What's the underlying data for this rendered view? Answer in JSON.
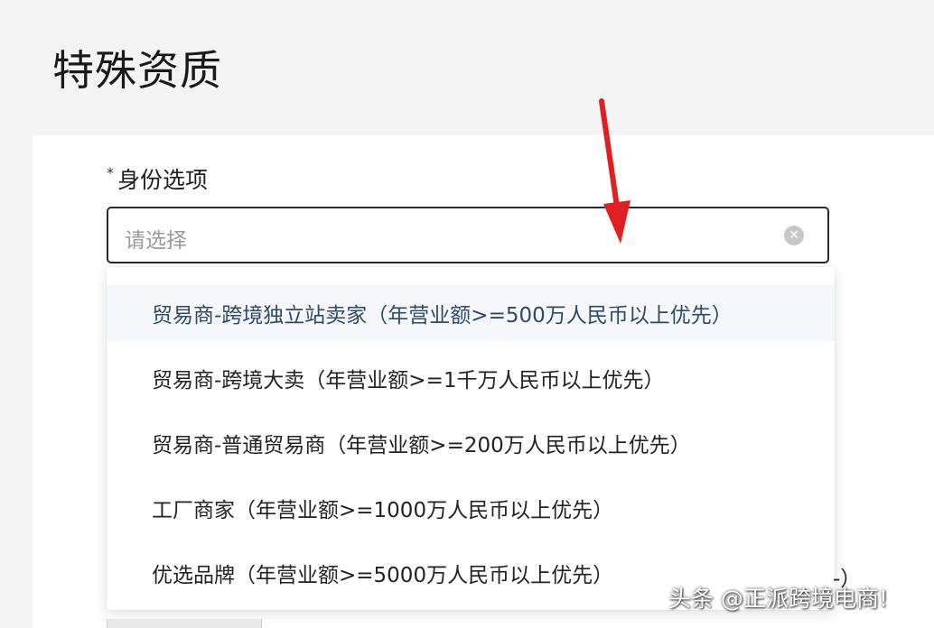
{
  "section": {
    "title": "特殊资质"
  },
  "form": {
    "identity_field": {
      "required_mark": "*",
      "label": "身份选项",
      "placeholder": "请选择",
      "clear_icon": "x-circle-icon"
    }
  },
  "dropdown": {
    "options": [
      {
        "label": "贸易商-跨境独立站卖家（年营业额>=500万人民币以上优先）",
        "hovered": true
      },
      {
        "label": "贸易商-跨境大卖（年营业额>=1千万人民币以上优先）"
      },
      {
        "label": "贸易商-普通贸易商（年营业额>=200万人民币以上优先）"
      },
      {
        "label": "工厂商家（年营业额>=1000万人民币以上优先）"
      },
      {
        "label": "优选品牌（年营业额>=5000万人民币以上优先）"
      }
    ]
  },
  "background_partial_text": "-）",
  "annotation": {
    "arrow_color": "#e02020"
  },
  "watermark": {
    "text": "头条 @正派跨境电商!"
  }
}
